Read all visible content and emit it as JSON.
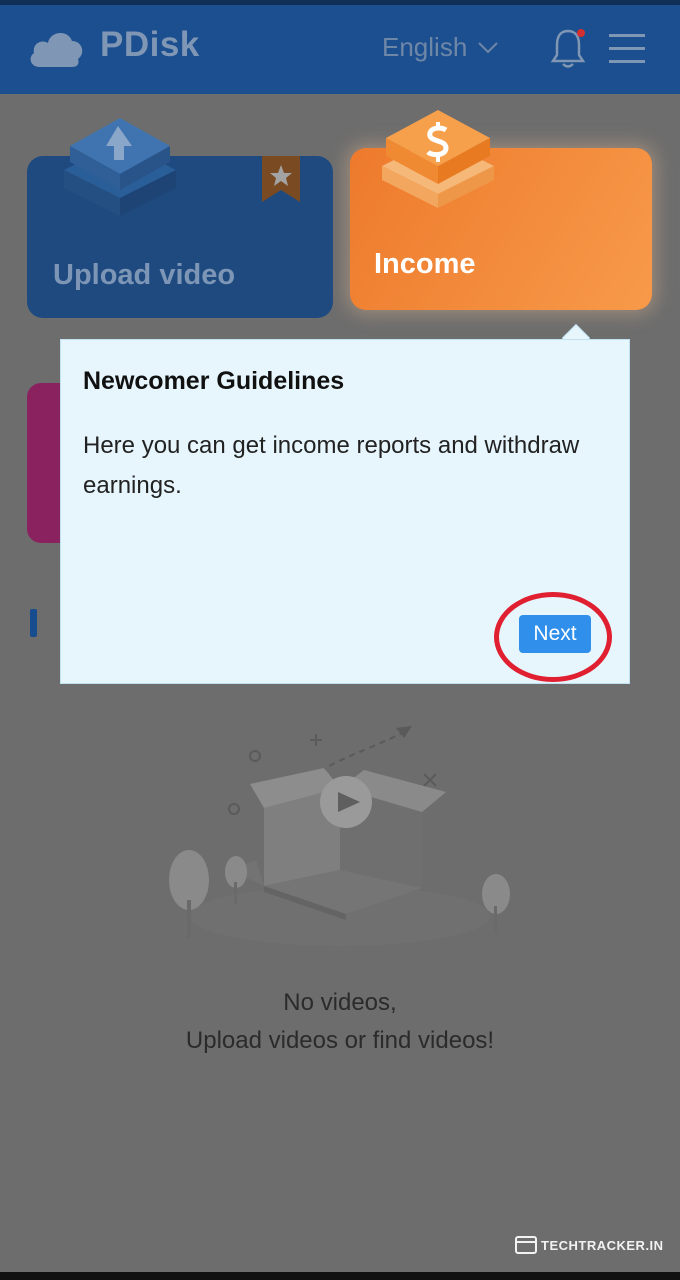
{
  "header": {
    "brand": "PDisk",
    "language": "English"
  },
  "cards": {
    "upload": {
      "label": "Upload video"
    },
    "income": {
      "label": "Income"
    }
  },
  "guide": {
    "title": "Newcomer Guidelines",
    "body": "Here you can get income reports and withdraw earnings.",
    "next_label": "Next"
  },
  "empty_state": {
    "line1": "No videos,",
    "line2": "Upload videos or find videos!"
  },
  "watermark": {
    "text": "TECHTRACKER.IN"
  },
  "icons": {
    "logo": "cloud-icon",
    "language_toggle": "chevron-down-icon",
    "notifications": "bell-icon",
    "menu": "menu-icon",
    "upload_card": "upload-arrow-icon",
    "income_card": "currency-icon",
    "favorite": "star-ribbon-icon"
  },
  "colors": {
    "header": "#1c4f8f",
    "overlay": "#6d6d6d",
    "income_card": "#f0842f",
    "popup_bg": "#e7f6fd",
    "next_button": "#2f8fea",
    "highlight_ring": "#e02030"
  }
}
